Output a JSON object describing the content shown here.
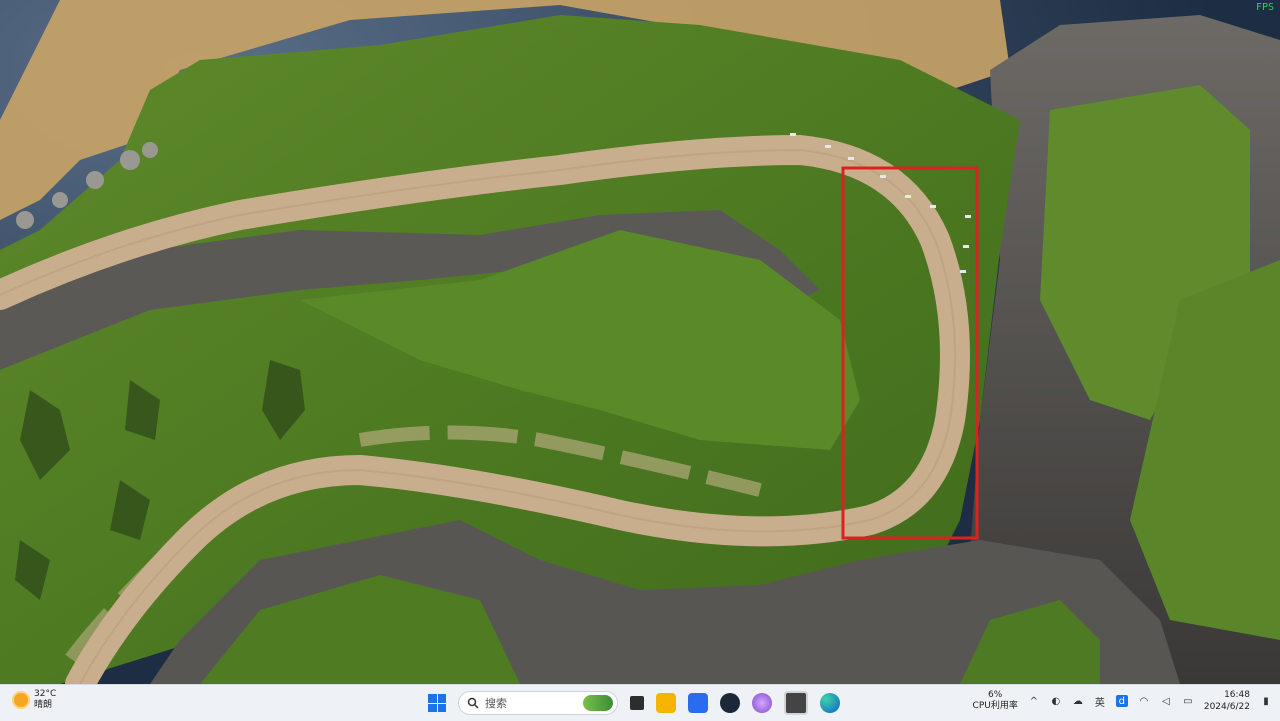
{
  "game": {
    "fps_label": "FPS",
    "highlight_color": "#e02020"
  },
  "taskbar": {
    "weather": {
      "temperature": "32°C",
      "condition": "晴朗"
    },
    "search_placeholder": "搜索",
    "cpu": {
      "percent": "6%",
      "label": "CPU利用率"
    },
    "tray": {
      "ime_label": "英",
      "time": "16:48",
      "date": "2024/6/22"
    },
    "apps": [
      "windows-start-icon",
      "file-explorer-icon",
      "folder-icon",
      "feishu-icon",
      "steam-icon",
      "browser-icon",
      "game-app-icon",
      "edge-icon"
    ]
  }
}
